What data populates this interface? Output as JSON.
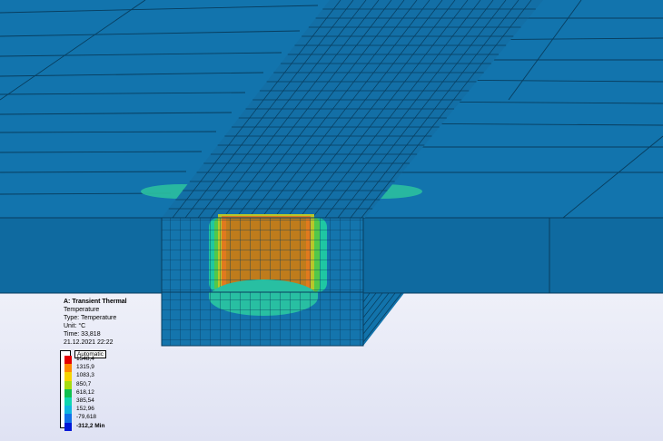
{
  "analysis": {
    "title": "A: Transient Thermal",
    "result": "Temperature",
    "type": "Type: Temperature",
    "unit": "Unit: °C",
    "time": "Time: 33,818",
    "date": "21.12.2021 22:22"
  },
  "legend": {
    "mode": "Automatic",
    "max_value": "1548,4",
    "labels": [
      "1548,4",
      "1315,9",
      "1083,3",
      "850,7",
      "618,12",
      "385,54",
      "152,96",
      "-79,618",
      "-312,2 Min"
    ],
    "colors": [
      "#e40000",
      "#ff8a00",
      "#f6d400",
      "#a6dc10",
      "#10c050",
      "#10d7b0",
      "#10b7e0",
      "#1070e8",
      "#0018d8"
    ]
  },
  "colors": {
    "base_blue": "#0f6fa8",
    "background": "#ffffff",
    "hot_core": "#bf7c1c"
  }
}
